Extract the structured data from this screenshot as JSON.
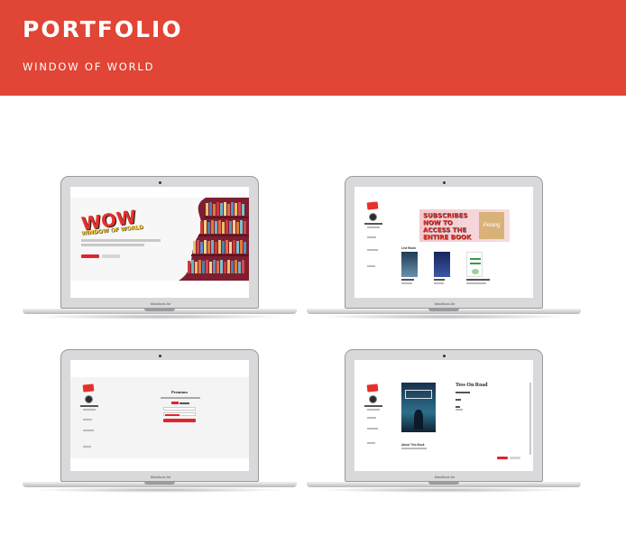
{
  "header": {
    "title": "PORTFOLIO",
    "subtitle": "WINDOW OF WORLD",
    "accent": "#e04535"
  },
  "laptop_brand": "MacBook Air",
  "screens": {
    "landing": {
      "logo_main": "WOW",
      "logo_sub": "WINDOW OF WORLD"
    },
    "library": {
      "banner_text": "SUBSCRIBES NOW TO ACCESS THE ENTIRE BOOK",
      "banner_book": "Pelang",
      "list_title": "List Book"
    },
    "subscription": {
      "form_title": "Premium"
    },
    "detail": {
      "book_title": "Tess On Road",
      "about_title": "About This Book"
    }
  }
}
